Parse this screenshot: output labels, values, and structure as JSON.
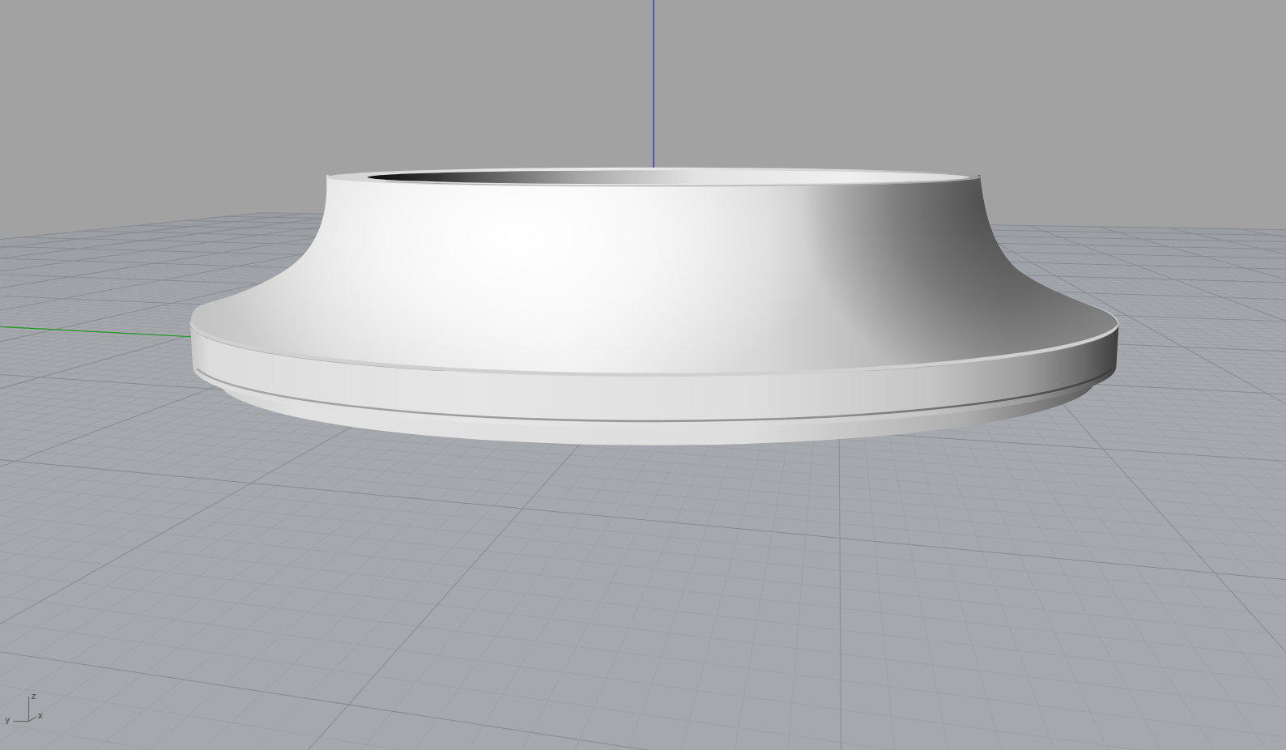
{
  "viewport": {
    "axis_gizmo": {
      "labels": [
        {
          "kind": "z",
          "text": "z"
        },
        {
          "kind": "y",
          "text": "y"
        },
        {
          "kind": "x",
          "text": "x"
        }
      ]
    }
  }
}
